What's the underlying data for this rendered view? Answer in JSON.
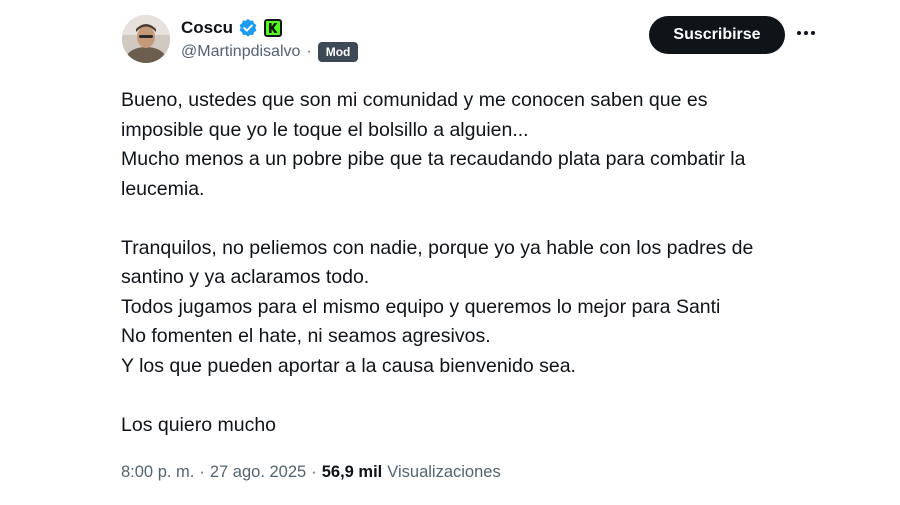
{
  "author": {
    "display_name": "Coscu",
    "handle": "@Martinpdisalvo",
    "badge": "Mod",
    "verified_icon": "verified-check-icon",
    "affiliate_icon": "k-badge-icon"
  },
  "actions": {
    "subscribe_label": "Suscribirse",
    "more_icon": "more-horizontal-icon"
  },
  "tweet": {
    "lines": [
      "Bueno, ustedes que son mi comunidad y me conocen saben que es",
      "imposible que yo le toque el bolsillo a alguien...",
      "Mucho menos a un pobre pibe que ta recaudando plata para combatir la",
      "leucemia.",
      "",
      "Tranquilos, no peliemos con nadie, porque yo ya hable con los padres de",
      "santino y ya aclaramos todo.",
      "Todos jugamos para el mismo equipo y queremos lo mejor para Santi",
      "No fomenten el hate, ni seamos agresivos.",
      "Y los que pueden aportar a la causa bienvenido sea.",
      "",
      "Los quiero mucho"
    ]
  },
  "meta": {
    "time": "8:00 p. m.",
    "date": "27 ago. 2025",
    "separator": "·",
    "views_count": "56,9 mil",
    "views_label": "Visualizaciones"
  },
  "colors": {
    "text": "#0f1419",
    "secondary": "#536471",
    "verified": "#1d9bf0",
    "kick_green": "#53fc18",
    "mod_badge_bg": "#3d4a55",
    "button_bg": "#0f1419"
  }
}
